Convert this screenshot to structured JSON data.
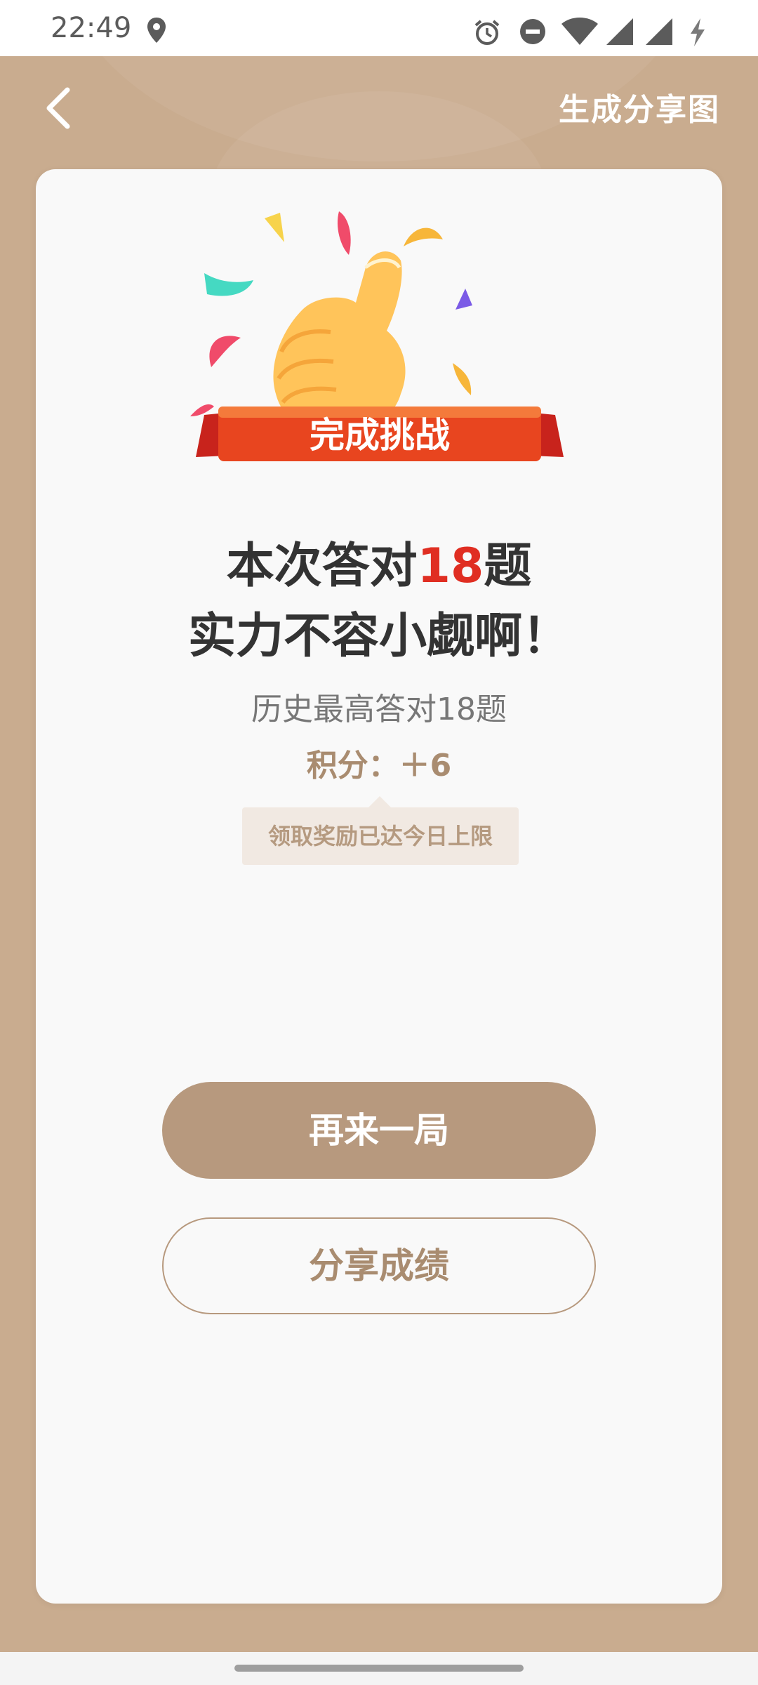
{
  "status_bar": {
    "time": "22:49",
    "icons": [
      "location-pin-icon",
      "alarm-icon",
      "do-not-disturb-icon",
      "wifi-icon",
      "signal-icon",
      "signal-icon-2",
      "battery-charging-icon"
    ]
  },
  "header": {
    "back_icon": "chevron-left-icon",
    "share_image_label": "生成分享图"
  },
  "result": {
    "badge_text": "完成挑战",
    "line1_prefix": "本次答对",
    "correct_count": "18",
    "line1_suffix": "题",
    "line2": "实力不容小觑啊！",
    "best_record": "历史最高答对18题",
    "points": "积分：＋6",
    "reward_tip": "领取奖励已达今日上限"
  },
  "actions": {
    "play_again": "再来一局",
    "share_score": "分享成绩"
  },
  "colors": {
    "background": "#c9ac8f",
    "accent": "#b7997e",
    "highlight": "#e02e22",
    "ribbon": "#e8451f"
  }
}
